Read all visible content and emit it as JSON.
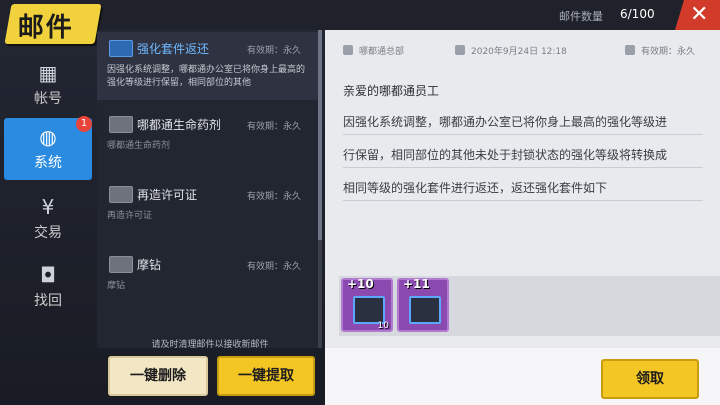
{
  "header": {
    "logo_text": "邮件",
    "count_label": "邮件数量",
    "count_value": "6/100",
    "close_symbol": "✕"
  },
  "sidebar": {
    "items": [
      {
        "label": "帐号",
        "icon": "id-card-icon",
        "glyph": "▦"
      },
      {
        "label": "系统",
        "icon": "globe-icon",
        "glyph": "◍",
        "badge": "1"
      },
      {
        "label": "交易",
        "icon": "yen-coin-icon",
        "glyph": "¥"
      },
      {
        "label": "找回",
        "icon": "backpack-icon",
        "glyph": "◘"
      }
    ]
  },
  "mail_list": [
    {
      "title": "强化套件返还",
      "expiry": "有效期：永久",
      "preview": "因强化系统调整，哪都通办公室已将你身上最高的强化等级进行保留，相同部位的其他"
    },
    {
      "title": "哪都通生命药剂",
      "expiry": "有效期：永久",
      "preview": "哪都通生命药剂"
    },
    {
      "title": "再造许可证",
      "expiry": "有效期：永久",
      "preview": "再造许可证"
    },
    {
      "title": "摩钻",
      "expiry": "有效期：永久",
      "preview": "摩钻"
    }
  ],
  "list_footer": {
    "hint": "请及时清理邮件以接收新邮件",
    "delete_all": "一键删除",
    "claim_all": "一键提取"
  },
  "detail": {
    "sender": "哪都通总部",
    "date": "2020年9月24日 12:18",
    "expiry": "有效期：永久",
    "greeting": "亲爱的哪都通员工",
    "body_lines": [
      "因强化系统调整，哪都通办公室已将你身上最高的强化等级进",
      "行保留，相同部位的其他未处于封锁状态的强化等级将转换成",
      "相同等级的强化套件进行返还，返还强化套件如下"
    ],
    "attachments": [
      {
        "level": "+10",
        "quantity": "10"
      },
      {
        "level": "+11",
        "quantity": ""
      }
    ],
    "claim_button": "领取"
  },
  "colors": {
    "accent_blue": "#2a8be0",
    "button_yellow": "#f4c623",
    "close_red": "#d23a2a",
    "item_purple": "#8a4ab0"
  }
}
